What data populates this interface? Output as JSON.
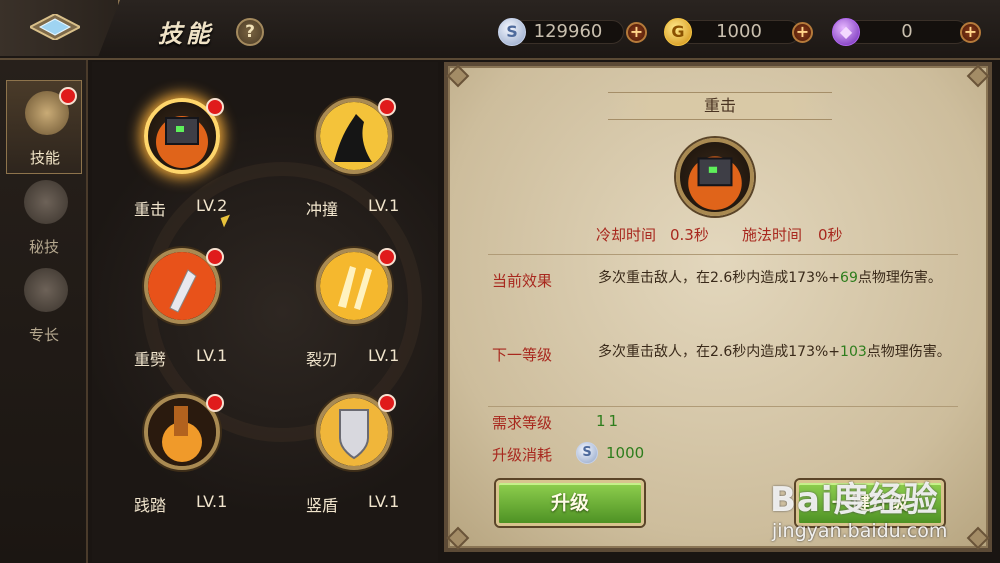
{
  "header": {
    "title": "技能",
    "help_label": "?",
    "currencies": [
      {
        "name": "silver",
        "icon": "silver-coin-icon",
        "value": "129960",
        "plus": "+"
      },
      {
        "name": "gold",
        "icon": "gold-coin-icon",
        "value": "1000",
        "plus": "+"
      },
      {
        "name": "gem",
        "icon": "purple-gem-icon",
        "value": "0",
        "plus": "+"
      }
    ]
  },
  "sidebar": {
    "items": [
      {
        "label": "技能",
        "icon": "skill-book-icon",
        "active": true
      },
      {
        "label": "秘技",
        "icon": "secret-skill-icon",
        "active": false
      },
      {
        "label": "专长",
        "icon": "specialty-icon",
        "active": false
      }
    ]
  },
  "skills": [
    {
      "name": "重击",
      "level": "LV.2",
      "icon": "heavy-strike-icon",
      "selected": true
    },
    {
      "name": "冲撞",
      "level": "LV.1",
      "icon": "charge-icon",
      "selected": false
    },
    {
      "name": "重劈",
      "level": "LV.1",
      "icon": "heavy-slash-icon",
      "selected": false
    },
    {
      "name": "裂刃",
      "level": "LV.1",
      "icon": "split-blade-icon",
      "selected": false
    },
    {
      "name": "践踏",
      "level": "LV.1",
      "icon": "stomp-icon",
      "selected": false
    },
    {
      "name": "竖盾",
      "level": "LV.1",
      "icon": "raise-shield-icon",
      "selected": false
    }
  ],
  "detail": {
    "name": "重击",
    "cooldown_label": "冷却时间",
    "cooldown_value": "0.3秒",
    "cast_label": "施法时间",
    "cast_value": "0秒",
    "current_label": "当前效果",
    "current_desc_pre": "多次重击敌人，在2.6秒内造成173%+",
    "current_desc_num": "69",
    "current_desc_post": "点物理伤害。",
    "next_label": "下一等级",
    "next_desc_pre": "多次重击敌人，在2.6秒内造成173%+",
    "next_desc_num": "103",
    "next_desc_post": "点物理伤害。",
    "req_level_label": "需求等级",
    "req_level_value": "11",
    "cost_label": "升级消耗",
    "cost_value": "1000",
    "upgrade_label": "升级",
    "one_click_label": "一键升级"
  },
  "watermark": {
    "title": "Bai度经验",
    "url": "jingyan.baidu.com"
  },
  "colors": {
    "accent_red": "#a8281e",
    "accent_green": "#2d7d1c",
    "gold_border": "#a98a52"
  }
}
